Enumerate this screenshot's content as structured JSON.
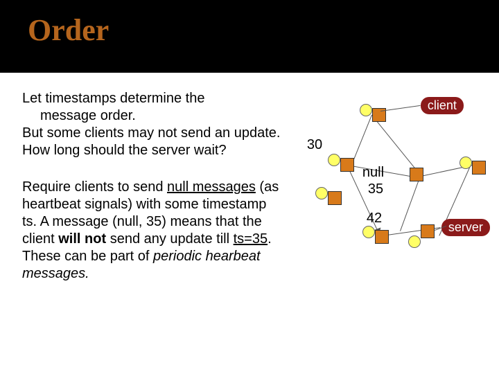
{
  "title": "Order",
  "para1": {
    "l1a": " Let timestamps determine the",
    "l1b": "message order.",
    "l2": "But some clients may not send an update.",
    "l3": "How long should the server wait?"
  },
  "para2": {
    "pre": "Require clients to send ",
    "null_msgs": "null messages",
    "mid1": " (as heartbeat signals) with some timestamp ts. A message (null, 35) means that the client ",
    "willnot": "will not",
    "mid2": " send any update till ",
    "ts35": "ts=35",
    "end1": ". These can be part of ",
    "periodic": "periodic hearbeat messages.",
    "dot": ""
  },
  "labels": {
    "v30": "30",
    "nullw": "null",
    "v35": "35",
    "v42": "42",
    "client": "client",
    "server": "server"
  }
}
